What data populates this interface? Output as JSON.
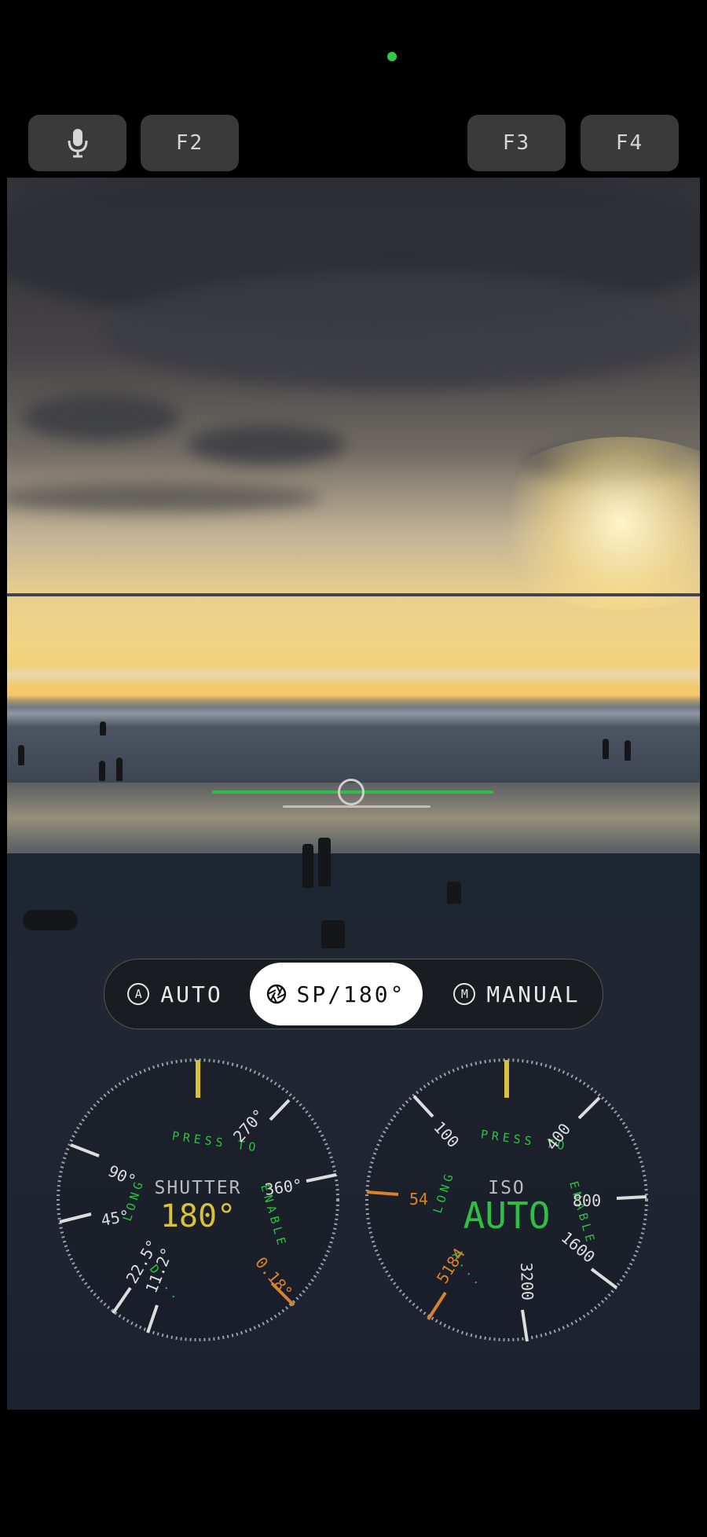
{
  "status": {
    "indicator_color": "#2ecc40"
  },
  "top_bar": {
    "mic_icon": "microphone-icon",
    "f2": "F2",
    "f3": "F3",
    "f4": "F4"
  },
  "modes": {
    "auto_badge": "A",
    "auto": "AUTO",
    "sp_icon": "aperture-icon",
    "sp": "SP/180°",
    "manual_badge": "M",
    "manual": "MANUAL",
    "selected": "SP/180°"
  },
  "shutter_dial": {
    "label": "SHUTTER",
    "value": "180°",
    "hint_upper": "PRESS TO",
    "hint_left": "LONG",
    "hint_right": "ENABLE",
    "hint_lower": "D...",
    "ticks": [
      "270°",
      "360°",
      "90°",
      "45°",
      "22.5°",
      "11.2°",
      "0.18°"
    ]
  },
  "iso_dial": {
    "label": "ISO",
    "value": "AUTO",
    "hint_upper": "PRESS TO",
    "hint_left": "LONG",
    "hint_right": "ENABLE",
    "hint_lower": "A...",
    "ticks": [
      "100",
      "400",
      "800",
      "1600",
      "3200",
      "5184",
      "54"
    ]
  },
  "colors": {
    "accent_green": "#2fbf45",
    "accent_yellow": "#d8c23a",
    "accent_orange": "#d9822b"
  }
}
